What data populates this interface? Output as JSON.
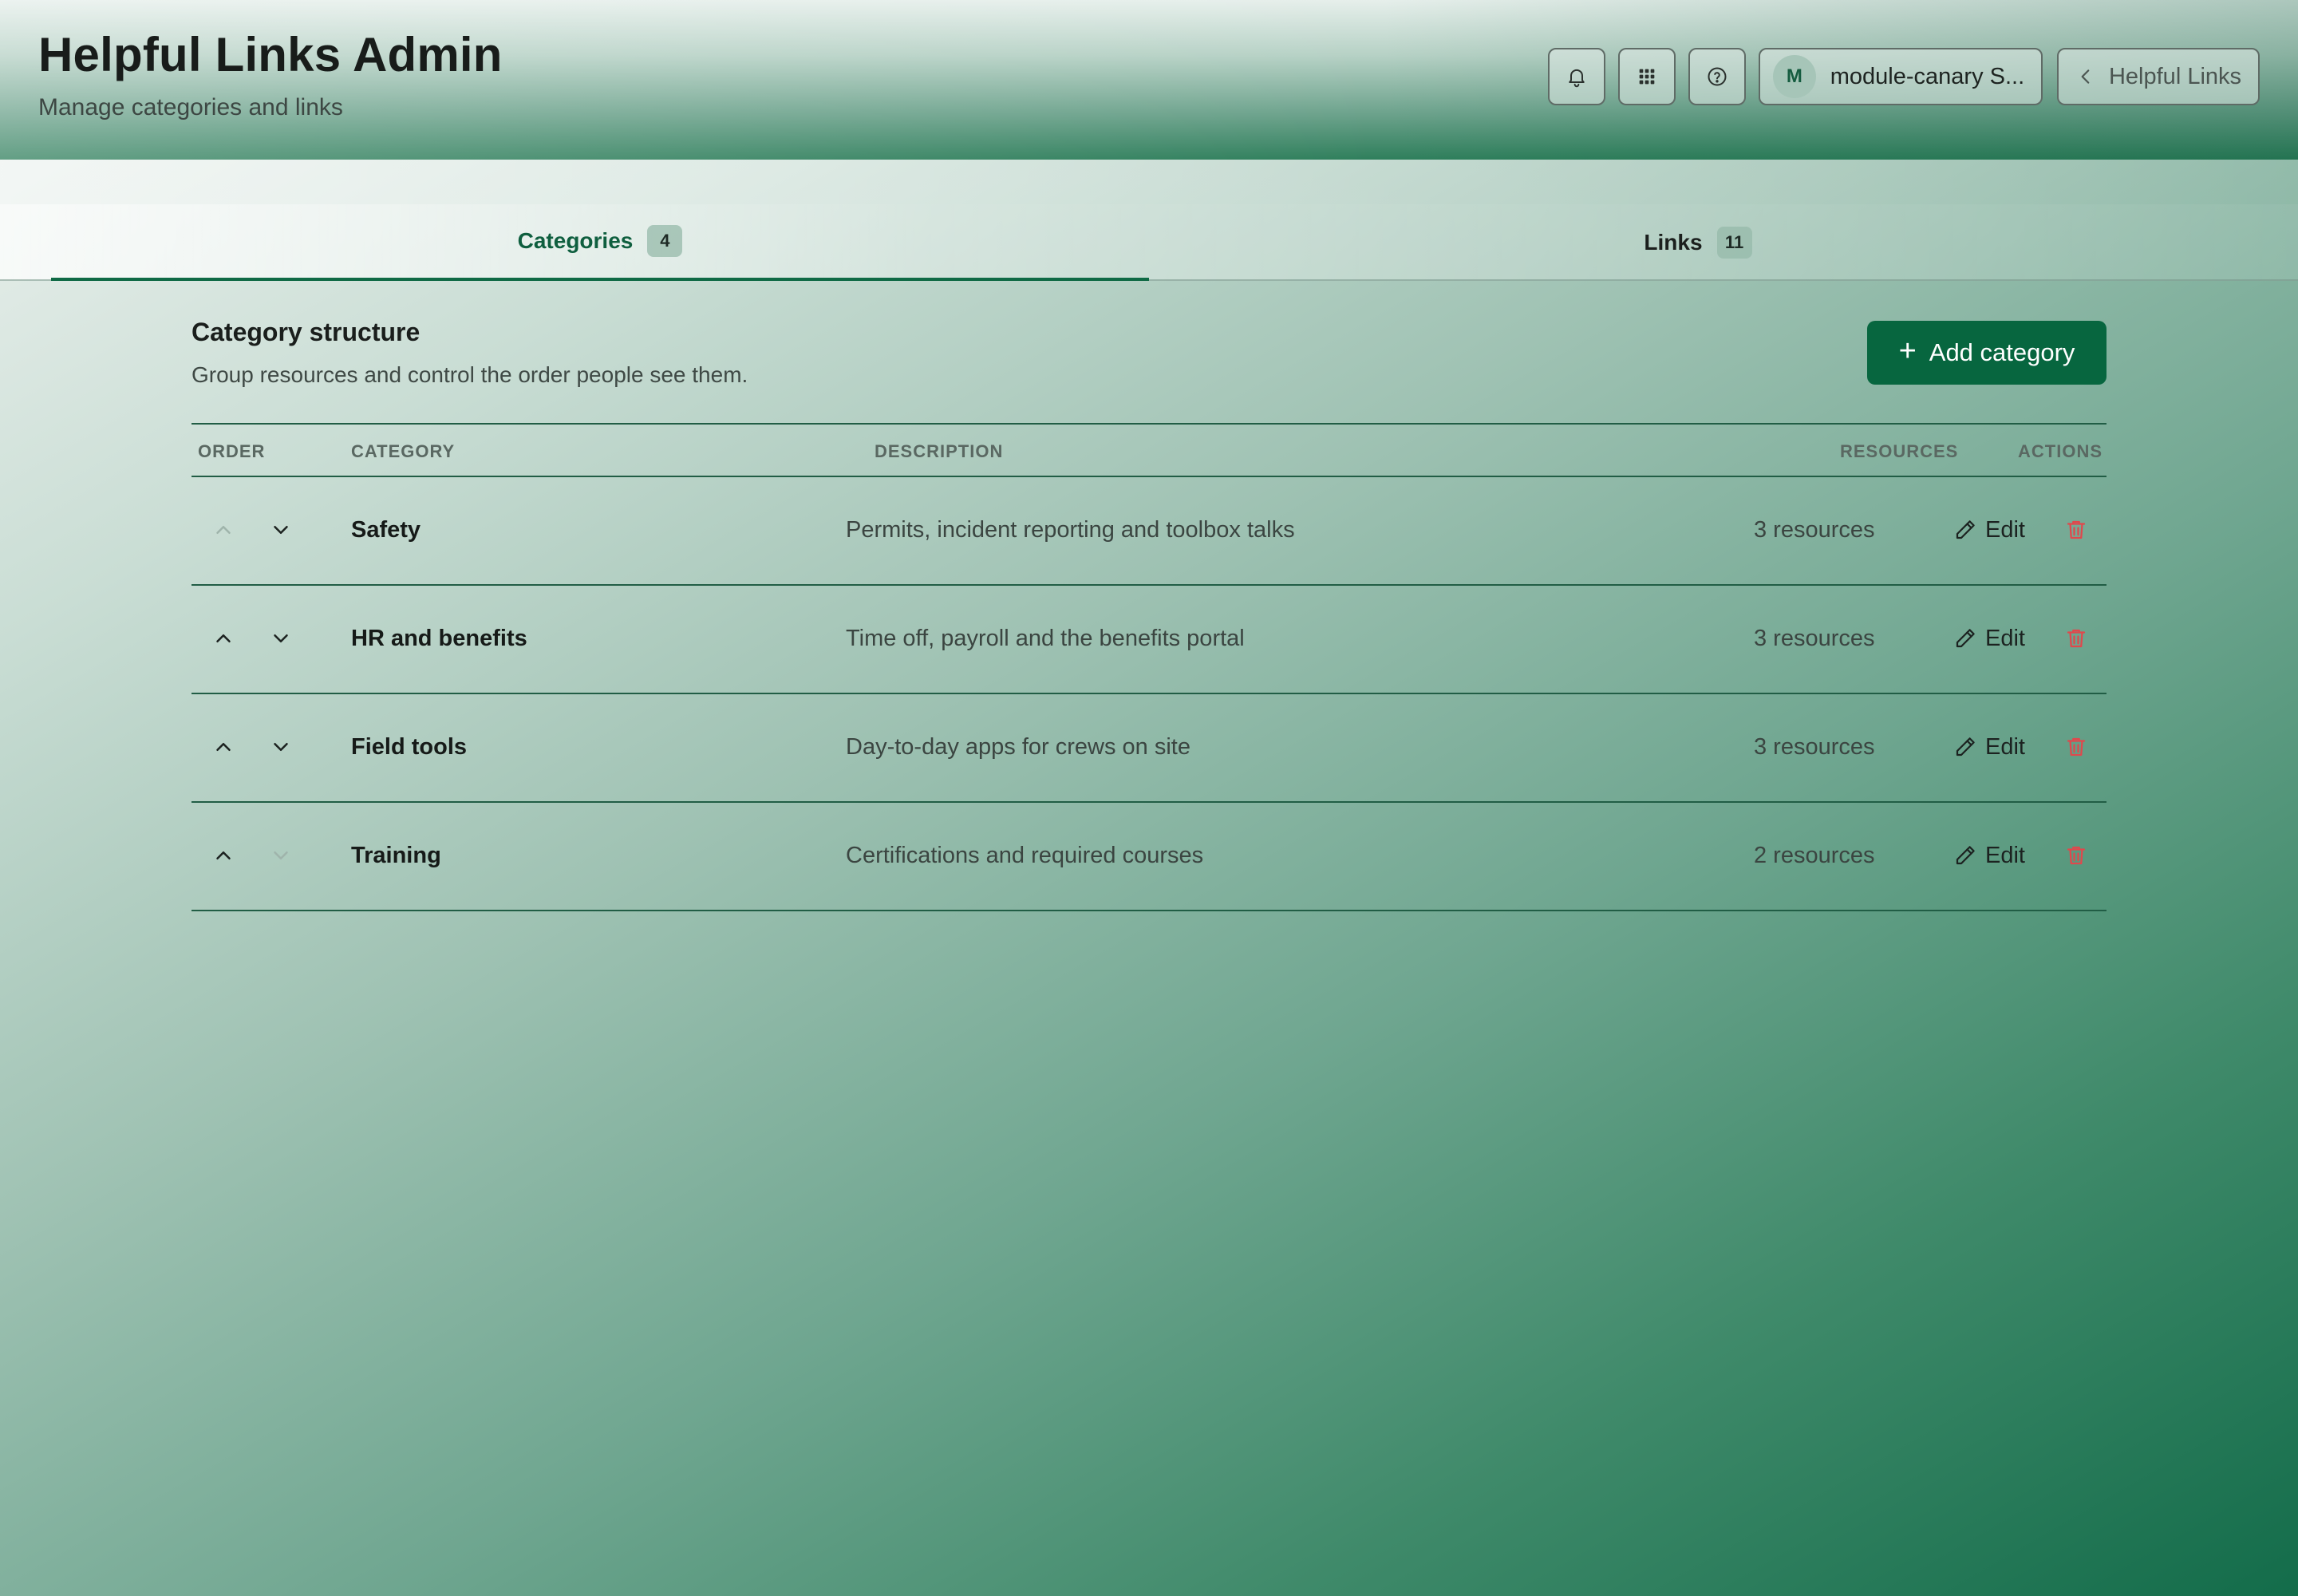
{
  "header": {
    "title": "Helpful Links Admin",
    "subtitle": "Manage categories and links",
    "icons": [
      "bell-icon",
      "apps-grid-icon",
      "help-icon"
    ],
    "workspace": {
      "avatar_initial": "M",
      "name": "module-canary S..."
    },
    "back_label": "Helpful Links"
  },
  "tabs": [
    {
      "label": "Categories",
      "count": "4",
      "active": true
    },
    {
      "label": "Links",
      "count": "11",
      "active": false
    }
  ],
  "section": {
    "title": "Category structure",
    "subtitle": "Group resources and control the order people see them.",
    "add_button_label": "Add category"
  },
  "table": {
    "headers": {
      "order": "ORDER",
      "category": "CATEGORY",
      "description": "DESCRIPTION",
      "resources": "RESOURCES",
      "actions": "ACTIONS"
    },
    "edit_label": "Edit",
    "rows": [
      {
        "name": "Safety",
        "description": "Permits, incident reporting and toolbox talks",
        "resources": "3 resources",
        "can_move_up": false,
        "can_move_down": true
      },
      {
        "name": "HR and benefits",
        "description": "Time off, payroll and the benefits portal",
        "resources": "3 resources",
        "can_move_up": true,
        "can_move_down": true
      },
      {
        "name": "Field tools",
        "description": "Day-to-day apps for crews on site",
        "resources": "3 resources",
        "can_move_up": true,
        "can_move_down": true
      },
      {
        "name": "Training",
        "description": "Certifications and required courses",
        "resources": "2 resources",
        "can_move_up": true,
        "can_move_down": false
      }
    ]
  },
  "colors": {
    "primary": "#07663f",
    "danger": "#e0484c",
    "accent_text": "#0f5f3f"
  }
}
